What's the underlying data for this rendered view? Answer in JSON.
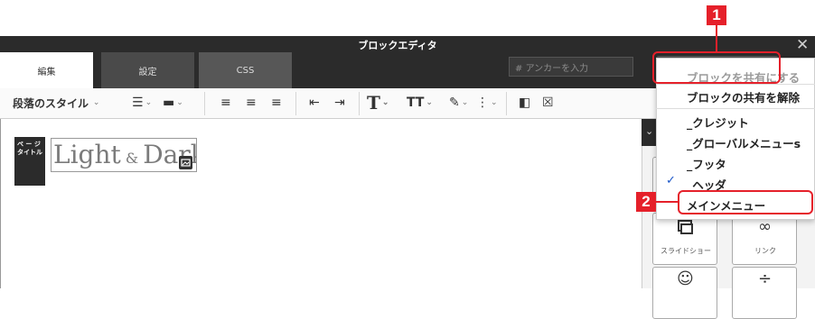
{
  "window": {
    "title": "ブロックエディタ"
  },
  "tabs": [
    {
      "label": "編集"
    },
    {
      "label": "設定"
    },
    {
      "label": "CSS"
    }
  ],
  "anchor_input": {
    "placeholder": "アンカーを入力"
  },
  "toolbar": {
    "paragraph_style": "段落のスタイル",
    "bold_T": "T",
    "font_size_T": "TT"
  },
  "content": {
    "badge_line1": "ペ ー ジ",
    "badge_line2": "タイトル",
    "heading_part1": "Light",
    "heading_amp": " & ",
    "heading_part2": "Dark"
  },
  "dropdown": {
    "items": [
      {
        "label": "ブロックを共有にする"
      },
      {
        "label": "ブロックの共有を解除"
      },
      {
        "label": "_クレジット"
      },
      {
        "label": "_グローバルメニューs"
      },
      {
        "label": "_フッタ"
      },
      {
        "label": "_ヘッダ"
      },
      {
        "label": "メインメニュー"
      }
    ]
  },
  "panel": {
    "tiles": [
      {
        "label": "スライドショー"
      },
      {
        "label": "リンク"
      }
    ]
  },
  "annotations": {
    "marker1": "1",
    "marker2": "2"
  },
  "colors": {
    "accent_red": "#e5202a",
    "dark_bar": "#2b2b2b"
  }
}
